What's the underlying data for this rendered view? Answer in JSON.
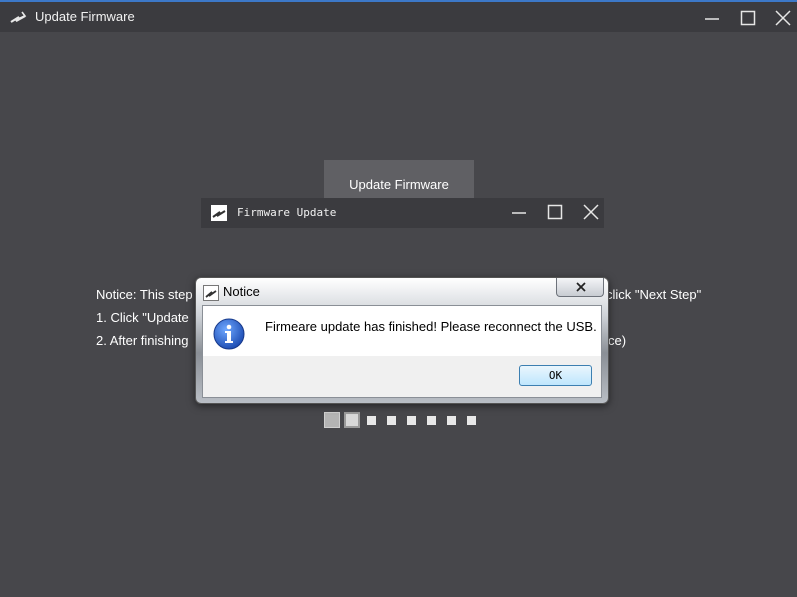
{
  "window": {
    "title": "Update Firmware",
    "icon": "app-logo-icon"
  },
  "main": {
    "button_label": "Update Firmware",
    "notice_line1": "Notice: This step",
    "notice_line2": "1. Click \"Update",
    "notice_line3": "2. After finishing",
    "right_frag1": "click \"Next Step\"",
    "right_frag2": "ce)",
    "step_count": 8,
    "current_step": 2
  },
  "child_window": {
    "title": "Firmware Update"
  },
  "dialog": {
    "title": "Notice",
    "message": "Firmeare update has finished! Please reconnect the USB.",
    "ok_label": "OK",
    "icon": "info-icon"
  },
  "colors": {
    "background": "#47474b",
    "titlebar": "#3b3b3f",
    "accent": "#3c78c8"
  }
}
